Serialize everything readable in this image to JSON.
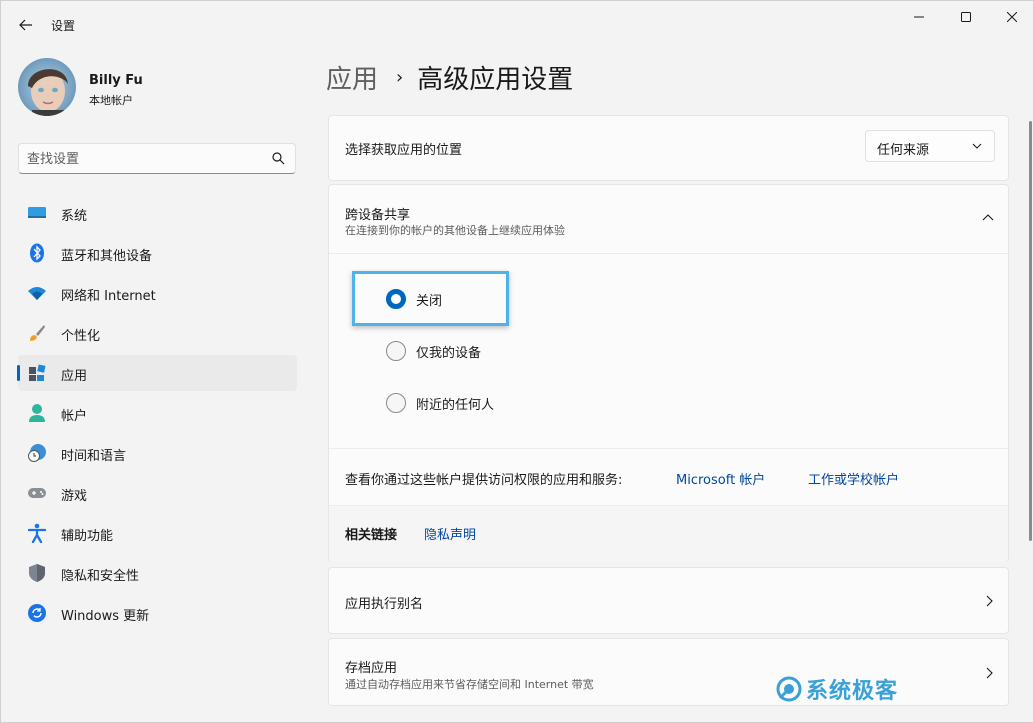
{
  "window": {
    "title": "设置"
  },
  "user": {
    "name": "Billy Fu",
    "account_type": "本地帐户"
  },
  "search": {
    "placeholder": "查找设置"
  },
  "sidebar": {
    "items": [
      {
        "label": "系统",
        "icon": "system-icon"
      },
      {
        "label": "蓝牙和其他设备",
        "icon": "bluetooth-icon"
      },
      {
        "label": "网络和 Internet",
        "icon": "wifi-icon"
      },
      {
        "label": "个性化",
        "icon": "brush-icon"
      },
      {
        "label": "应用",
        "icon": "apps-icon",
        "active": true
      },
      {
        "label": "帐户",
        "icon": "person-icon"
      },
      {
        "label": "时间和语言",
        "icon": "globe-clock-icon"
      },
      {
        "label": "游戏",
        "icon": "gamepad-icon"
      },
      {
        "label": "辅助功能",
        "icon": "accessibility-icon"
      },
      {
        "label": "隐私和安全性",
        "icon": "shield-icon"
      },
      {
        "label": "Windows 更新",
        "icon": "update-icon"
      }
    ]
  },
  "breadcrumb": {
    "parent": "应用",
    "separator": "›",
    "current": "高级应用设置"
  },
  "install_source": {
    "title": "选择获取应用的位置",
    "selected": "任何来源"
  },
  "cross_device": {
    "title": "跨设备共享",
    "subtitle": "在连接到你的帐户的其他设备上继续应用体验",
    "options": [
      {
        "label": "关闭",
        "checked": true
      },
      {
        "label": "仅我的设备",
        "checked": false
      },
      {
        "label": "附近的任何人",
        "checked": false
      }
    ],
    "accounts_text": "查看你通过这些帐户提供访问权限的应用和服务:",
    "link_microsoft": "Microsoft 帐户",
    "link_work": "工作或学校帐户",
    "related_label": "相关链接",
    "privacy_link": "隐私声明"
  },
  "app_alias": {
    "title": "应用执行别名"
  },
  "archive": {
    "title": "存档应用",
    "subtitle": "通过自动存档应用来节省存储空间和 Internet 带宽"
  },
  "watermark": {
    "text": "系统极客"
  },
  "colors": {
    "accent": "#0067c0",
    "link": "#0047a3",
    "highlight": "#4fb3ea"
  }
}
